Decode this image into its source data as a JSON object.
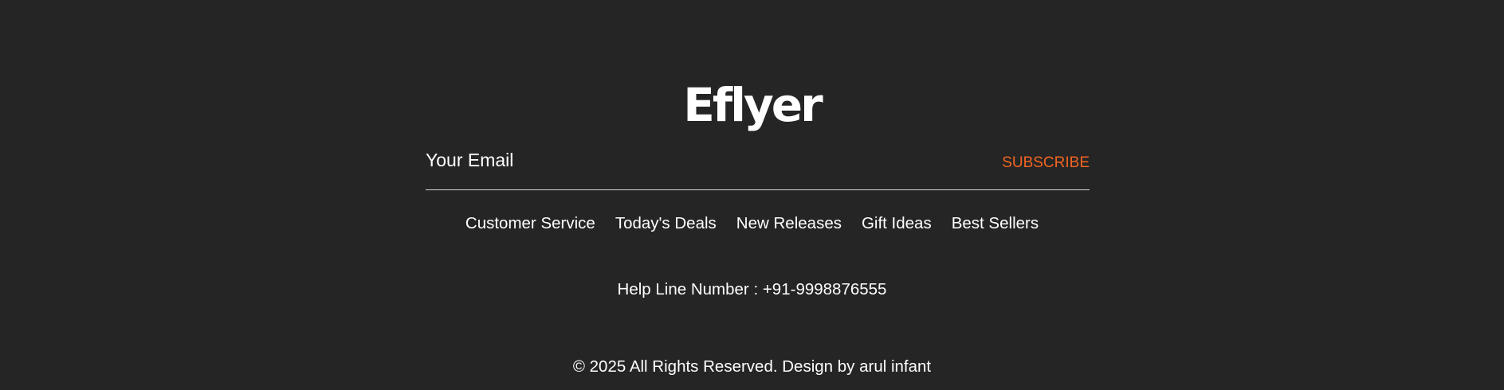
{
  "brand": {
    "logo_text": "Eflyer"
  },
  "newsletter": {
    "email_placeholder": "Your Email",
    "subscribe_label": "SUBSCRIBE"
  },
  "nav": {
    "items": [
      {
        "label": "Customer Service"
      },
      {
        "label": "Today's Deals"
      },
      {
        "label": "New Releases"
      },
      {
        "label": "Gift Ideas"
      },
      {
        "label": "Best Sellers"
      }
    ]
  },
  "helpline": {
    "text": "Help Line Number : +91-9998876555"
  },
  "footer": {
    "copyright": "© 2025 All Rights Reserved. Design by arul infant"
  },
  "colors": {
    "background": "#252525",
    "text": "#ffffff",
    "accent": "#f26522",
    "divider": "#d9d9d9"
  }
}
